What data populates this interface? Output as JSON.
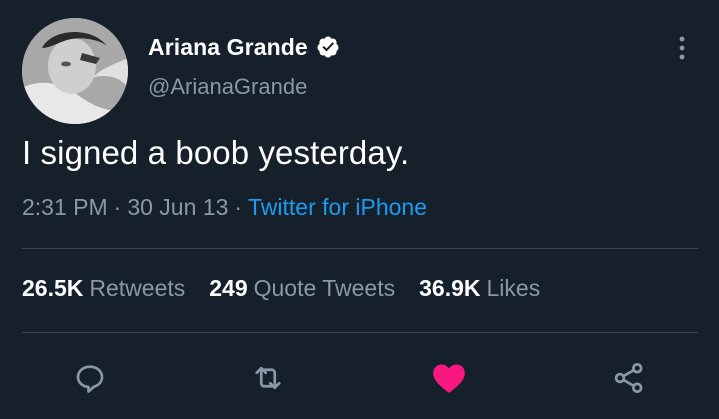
{
  "user": {
    "display_name": "Ariana Grande",
    "handle": "@ArianaGrande",
    "verified": true,
    "avatar_icon": "profile-photo"
  },
  "tweet": {
    "text": "I signed a boob yesterday.",
    "time": "2:31 PM",
    "separator": "·",
    "date": "30 Jun 13",
    "source": "Twitter for iPhone"
  },
  "stats": {
    "retweets_count": "26.5K",
    "retweets_label": "Retweets",
    "quotes_count": "249",
    "quotes_label": "Quote Tweets",
    "likes_count": "36.9K",
    "likes_label": "Likes"
  },
  "actions": {
    "reply_icon": "reply-icon",
    "retweet_icon": "retweet-icon",
    "like_icon": "heart-icon",
    "share_icon": "share-icon",
    "liked": true
  },
  "colors": {
    "background": "#15202b",
    "text_primary": "#ffffff",
    "text_secondary": "#8899a6",
    "link": "#1d9bf0",
    "like_active": "#f91880",
    "divider": "#38444d"
  }
}
